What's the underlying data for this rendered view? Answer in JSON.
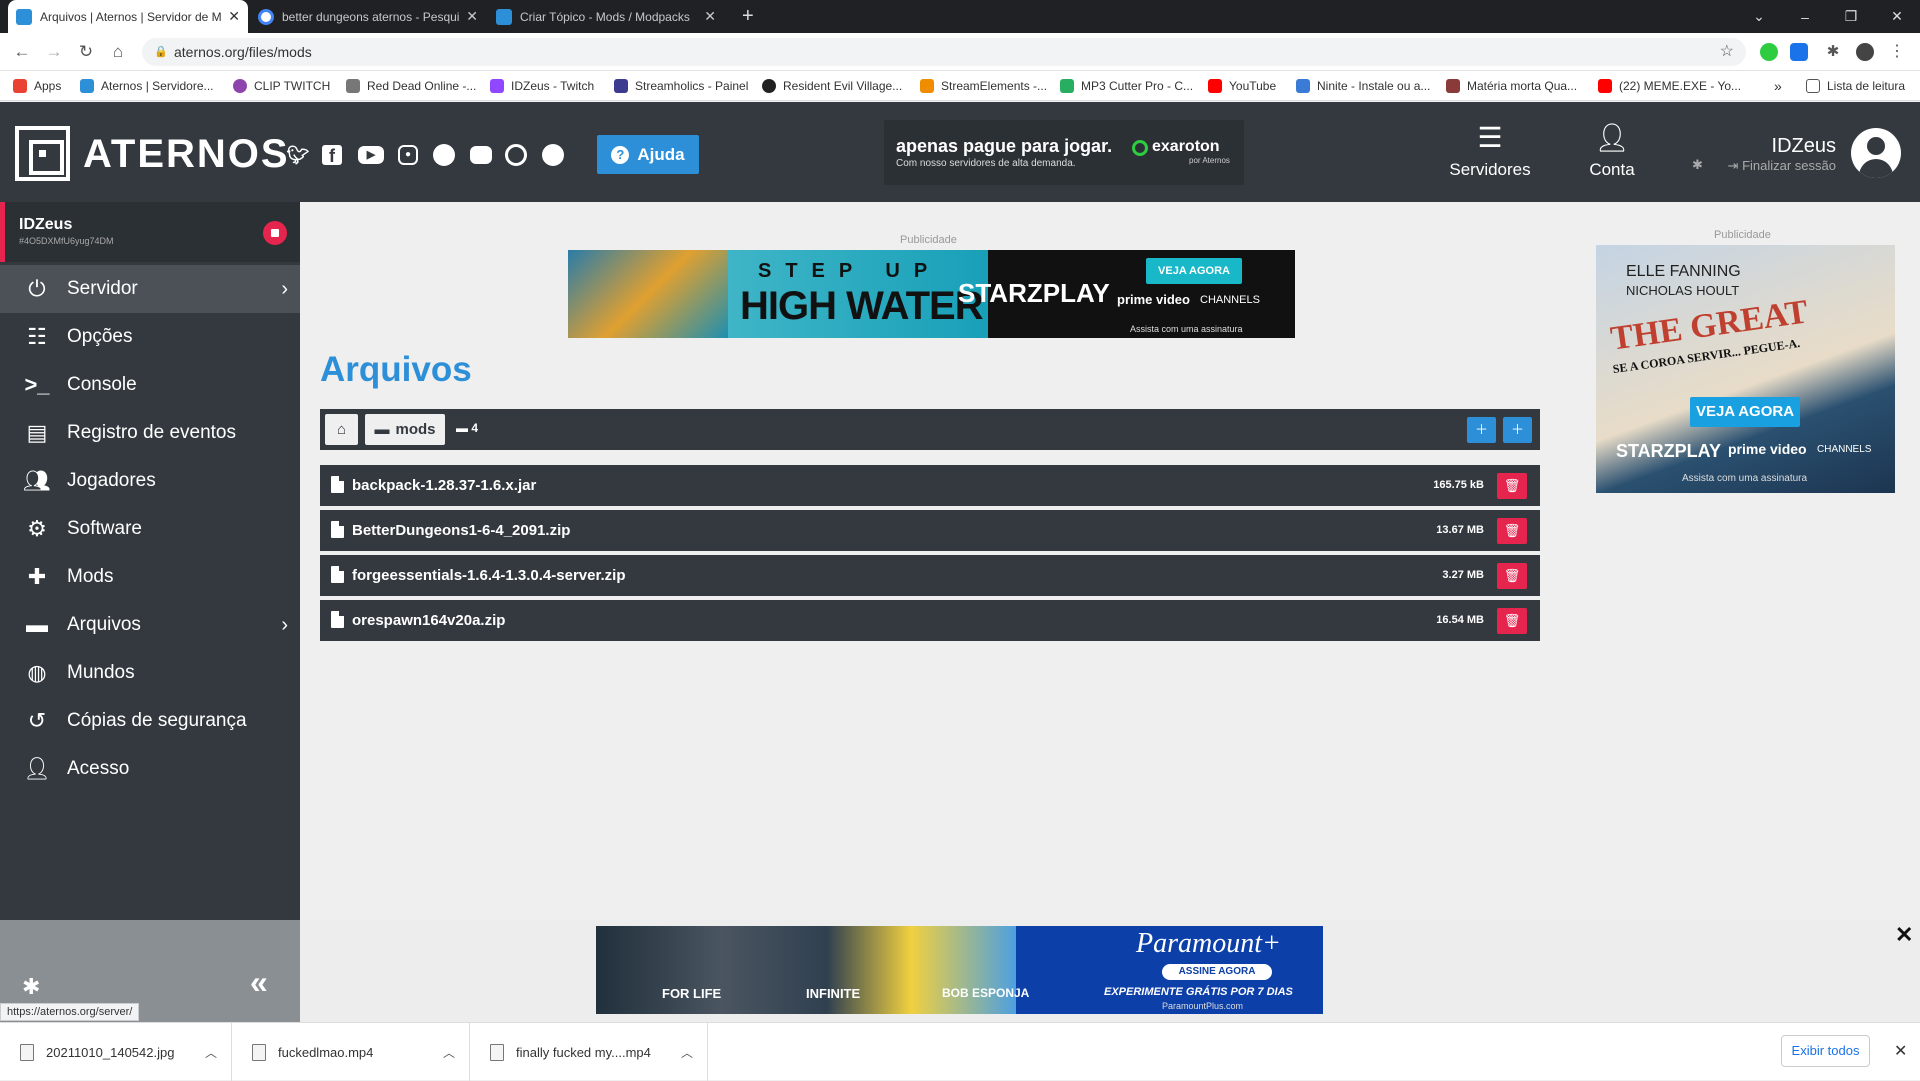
{
  "browser": {
    "tabs": [
      {
        "title": "Arquivos | Aternos | Servidor de M",
        "active": true,
        "color": "#2d8fd8"
      },
      {
        "title": "better dungeons aternos - Pesquis",
        "active": false,
        "color": "#4285f4"
      },
      {
        "title": "Criar Tópico - Mods / Modpacks",
        "active": false,
        "color": "#2d8fd8"
      }
    ],
    "new_tab": "+",
    "url": "aternos.org/files/mods",
    "bookmarks": [
      {
        "label": "Apps",
        "color": "#e94235"
      },
      {
        "label": "Aternos | Servidore...",
        "color": "#2d8fd8"
      },
      {
        "label": "CLIP TWITCH",
        "color": "#8e44ad"
      },
      {
        "label": "Red Dead Online -...",
        "color": "#777777"
      },
      {
        "label": "IDZeus - Twitch",
        "color": "#9146ff"
      },
      {
        "label": "Streamholics - Painel",
        "color": "#3b3b8f"
      },
      {
        "label": "Resident Evil Village...",
        "color": "#222222"
      },
      {
        "label": "StreamElements -...",
        "color": "#f08c00"
      },
      {
        "label": "MP3 Cutter Pro - C...",
        "color": "#27ae60"
      },
      {
        "label": "YouTube",
        "color": "#ff0000"
      },
      {
        "label": "Ninite - Instale ou a...",
        "color": "#3a7bd5"
      },
      {
        "label": "Matéria morta Qua...",
        "color": "#8b3a3a"
      },
      {
        "label": "(22) MEME.EXE - Yo...",
        "color": "#ff0000"
      }
    ],
    "more_bookmarks": "»",
    "reading_list": "Lista de leitura"
  },
  "header": {
    "brand": "ATERNOS",
    "help_label": "Ajuda",
    "promo": {
      "headline": "apenas pague para jogar.",
      "sub": "Com nosso servidores de alta demanda.",
      "brand": "exaroton",
      "brand_sub": "por Aternos"
    },
    "nav": [
      {
        "label": "Servidores",
        "icon": "server-icon"
      },
      {
        "label": "Conta",
        "icon": "account-gear-icon"
      }
    ],
    "username": "IDZeus",
    "logout": "Finalizar sessão"
  },
  "server": {
    "name": "IDZeus",
    "id": "#4O5DXMfU6yug74DM"
  },
  "sidebar": {
    "items": [
      {
        "label": "Servidor",
        "icon": "power-icon",
        "chevron": true,
        "active": true
      },
      {
        "label": "Opções",
        "icon": "sliders-icon",
        "chevron": false,
        "active": false
      },
      {
        "label": "Console",
        "icon": "terminal-icon",
        "chevron": false,
        "active": false
      },
      {
        "label": "Registro de eventos",
        "icon": "document-icon",
        "chevron": false,
        "active": false
      },
      {
        "label": "Jogadores",
        "icon": "users-icon",
        "chevron": false,
        "active": false
      },
      {
        "label": "Software",
        "icon": "cogs-icon",
        "chevron": false,
        "active": false
      },
      {
        "label": "Mods",
        "icon": "puzzle-icon",
        "chevron": false,
        "active": false
      },
      {
        "label": "Arquivos",
        "icon": "folder-icon",
        "chevron": true,
        "active": false
      },
      {
        "label": "Mundos",
        "icon": "globe-icon",
        "chevron": false,
        "active": false
      },
      {
        "label": "Cópias de segurança",
        "icon": "history-icon",
        "chevron": false,
        "active": false
      },
      {
        "label": "Acesso",
        "icon": "user-lock-icon",
        "chevron": false,
        "active": false
      }
    ]
  },
  "status_url": "https://aternos.org/server/",
  "main": {
    "ad_label": "Publicidade",
    "title": "Arquivos",
    "path": {
      "folder": "mods",
      "count": "4"
    },
    "files": [
      {
        "name": "backpack-1.28.37-1.6.x.jar",
        "size": "165.75 kB"
      },
      {
        "name": "BetterDungeons1-6-4_2091.zip",
        "size": "13.67 MB"
      },
      {
        "name": "forgeessentials-1.6.4-1.3.0.4-server.zip",
        "size": "3.27 MB"
      },
      {
        "name": "orespawn164v20a.zip",
        "size": "16.54 MB"
      }
    ]
  },
  "ads": {
    "top": {
      "step": "STEP UP",
      "title": "HIGH WATER",
      "brand": "STARZPLAY",
      "cta": "VEJA AGORA",
      "prime": "prime video",
      "channels": "CHANNELS",
      "sub": "Assista com uma assinatura"
    },
    "right": {
      "label": "Publicidade",
      "actor1": "ELLE FANNING",
      "actor2": "NICHOLAS HOULT",
      "title": "THE GREAT",
      "tagline": "SE A COROA SERVIR... PEGUE-A.",
      "cta": "VEJA AGORA",
      "brand": "STARZPLAY",
      "prime": "prime video",
      "channels": "CHANNELS",
      "sub": "Assista com uma assinatura"
    },
    "bottom": {
      "cap1": "FOR LIFE",
      "cap2": "INFINITE",
      "cap3": "BOB ESPONJA",
      "brand": "Paramount+",
      "cta": "ASSINE AGORA",
      "offer": "EXPERIMENTE GRÁTIS POR 7 DIAS",
      "url": "ParamountPlus.com",
      "close": "✕"
    }
  },
  "downloads": {
    "items": [
      {
        "name": "20211010_140542.jpg"
      },
      {
        "name": "fuckedlmao.mp4"
      },
      {
        "name": "finally fucked my....mp4"
      }
    ],
    "show_all": "Exibir todos"
  },
  "colors": {
    "accent": "#2d8fd8",
    "danger": "#e5254d",
    "panel": "#33393f"
  }
}
